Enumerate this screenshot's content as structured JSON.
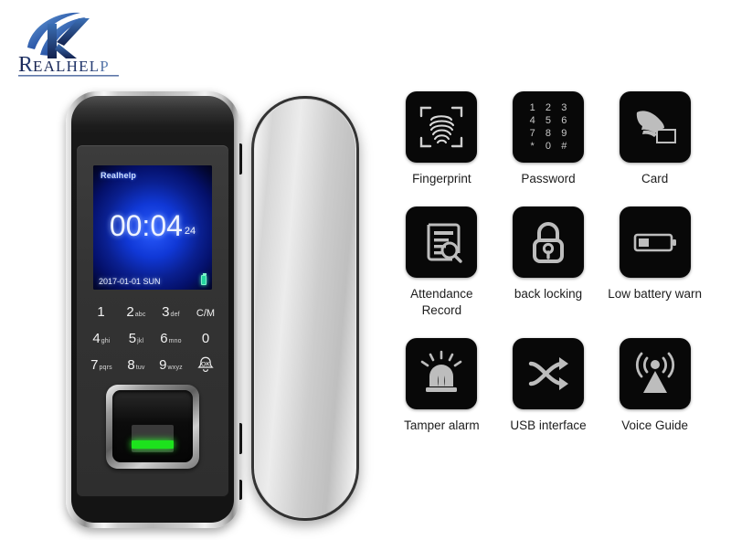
{
  "brand": {
    "logo_text_large": "R",
    "logo_text_rest": "EALHELP",
    "logo_color": "#1b2a6b",
    "logo_accent": "#2f6fc0"
  },
  "device": {
    "name": "smart-fingerprint-glass-door-lock",
    "screen": {
      "brand": "Realhelp",
      "time": "00:04",
      "seconds": "24",
      "date": "2017-01-01 SUN",
      "battery_color": "#25d6a0",
      "glow_color": "#1038d6"
    },
    "keypad": {
      "rows": [
        [
          {
            "digit": "1",
            "letters": ""
          },
          {
            "digit": "2",
            "letters": "abc"
          },
          {
            "digit": "3",
            "letters": "def"
          },
          {
            "digit": "C/M",
            "letters": ""
          }
        ],
        [
          {
            "digit": "4",
            "letters": "ghi"
          },
          {
            "digit": "5",
            "letters": "jkl"
          },
          {
            "digit": "6",
            "letters": "mno"
          },
          {
            "digit": "0",
            "letters": ""
          }
        ],
        [
          {
            "digit": "7",
            "letters": "pqrs"
          },
          {
            "digit": "8",
            "letters": "tuv"
          },
          {
            "digit": "9",
            "letters": "wxyz"
          },
          {
            "digit": "OK",
            "letters": ""
          }
        ]
      ]
    },
    "sensor": {
      "label": "fingerprint-sensor",
      "led_color": "#1de21d"
    },
    "handle": {
      "label": "glass-door-handle-plate"
    }
  },
  "features": [
    {
      "icon": "fingerprint-icon",
      "label": "Fingerprint"
    },
    {
      "icon": "password-keypad-icon",
      "label": "Password"
    },
    {
      "icon": "card-swipe-icon",
      "label": "Card"
    },
    {
      "icon": "attendance-record-icon",
      "label": "Attendance Record"
    },
    {
      "icon": "padlock-icon",
      "label": "back locking"
    },
    {
      "icon": "low-battery-icon",
      "label": "Low battery warn"
    },
    {
      "icon": "tamper-alarm-siren-icon",
      "label": "Tamper alarm"
    },
    {
      "icon": "usb-shuffle-arrows-icon",
      "label": "USB interface"
    },
    {
      "icon": "voice-guide-broadcast-icon",
      "label": "Voice Guide"
    }
  ],
  "password_icon_keys": [
    "1",
    "2",
    "3",
    "4",
    "5",
    "6",
    "7",
    "8",
    "9",
    "*",
    "0",
    "#"
  ]
}
